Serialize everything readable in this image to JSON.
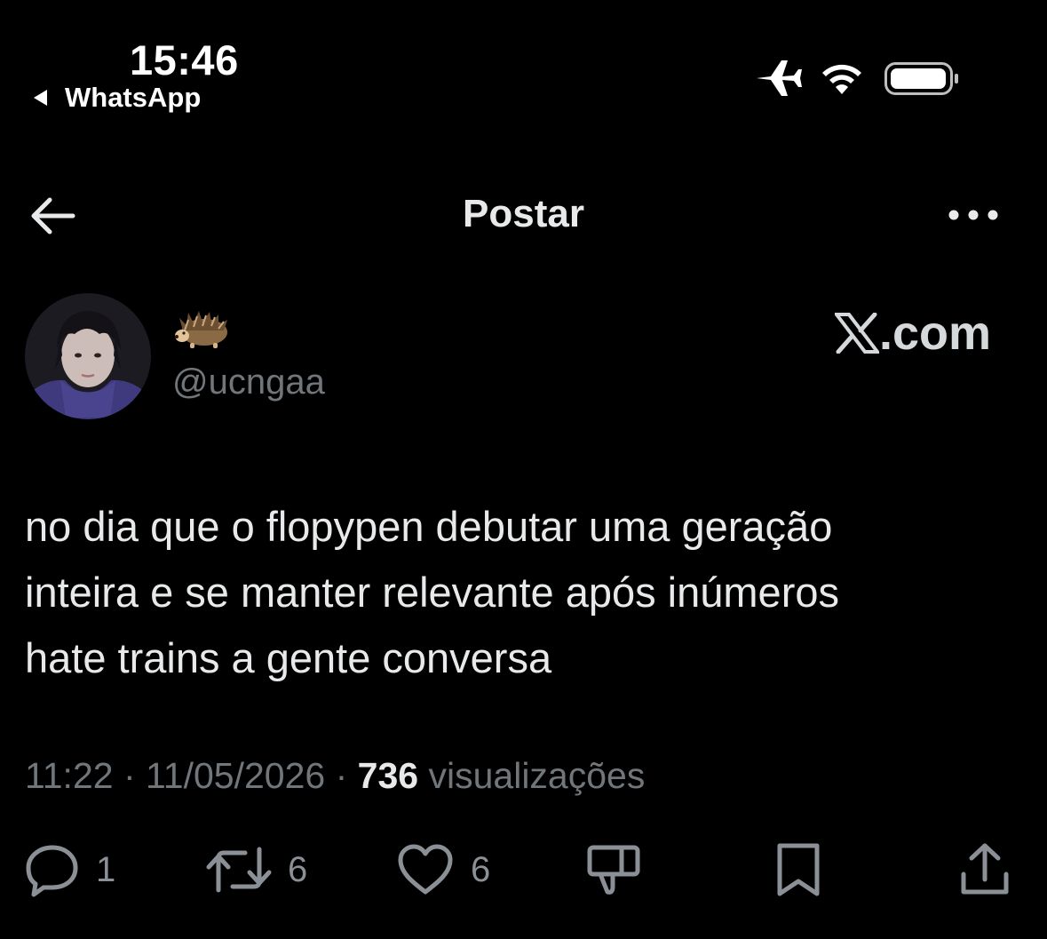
{
  "status_bar": {
    "time": "15:46",
    "back_app_label": "WhatsApp",
    "icons": [
      "airplane-icon",
      "wifi-icon",
      "battery-icon"
    ]
  },
  "header": {
    "title": "Postar",
    "back_icon": "arrow-left-icon",
    "more_icon": "more-horizontal-icon"
  },
  "post": {
    "author_display_name_emoji": "hedgehog-emoji",
    "author_handle": "@ucngaa",
    "watermark": ".com",
    "text_lines": [
      "no dia que o flopypen debutar uma geração",
      "inteira e se manter relevante após inúmeros",
      "hate trains a gente conversa"
    ],
    "time": "11:22",
    "separator": "·",
    "date": "11/05/2026",
    "views_count": "736",
    "views_label": "visualizações"
  },
  "actions": {
    "reply_count": "1",
    "repost_count": "6",
    "like_count": "6"
  },
  "colors": {
    "background": "#000000",
    "primary_text": "#e7e9ea",
    "secondary_text": "#71767b",
    "icon": "#8b9096"
  }
}
